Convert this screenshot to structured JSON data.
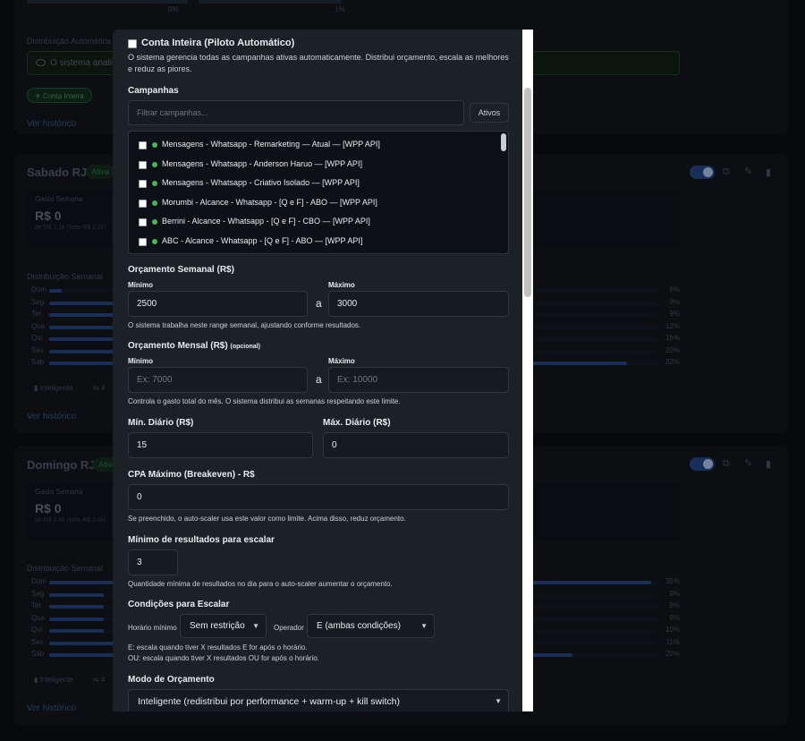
{
  "background": {
    "top_card": {
      "pct_left": "0%",
      "pct_right": "1%",
      "distribution_label": "Distribuição Automática",
      "auto_text": "O sistema analisa",
      "chip_label": "Conta Inteira",
      "history_link": "Ver histórico"
    },
    "cards": [
      {
        "title": "Sabado RJ",
        "status": "Ativa",
        "spend_label": "Gasto Semana",
        "spend_value": "R$ 0",
        "spend_sub": "de R$ 2.1k (falta R$ 2.1k)",
        "distribution_label": "Distribuição Semanal",
        "days": [
          {
            "day": "Dom",
            "pct": "6%",
            "fill": 0.02
          },
          {
            "day": "Seg",
            "pct": "9%",
            "fill": 0.14
          },
          {
            "day": "Ter",
            "pct": "9%",
            "fill": 0.14
          },
          {
            "day": "Qua",
            "pct": "12%",
            "fill": 0.18
          },
          {
            "day": "Qui",
            "pct": "16%",
            "fill": 0.24
          },
          {
            "day": "Sex",
            "pct": "20%",
            "fill": 0.26
          },
          {
            "day": "Sáb",
            "pct": "32%",
            "fill": 0.95
          }
        ],
        "tag_smart": "Inteligente",
        "tag_count": "4",
        "history_link": "Ver histórico"
      },
      {
        "title": "Domingo RJ",
        "status": "Ativa",
        "spend_label": "Gasto Semana",
        "spend_value": "R$ 0",
        "spend_sub": "de R$ 3.6k (falta R$ 3.6k)",
        "distribution_label": "Distribuição Semanal",
        "days": [
          {
            "day": "Dom",
            "pct": "35%",
            "fill": 0.99
          },
          {
            "day": "Seg",
            "pct": "9%",
            "fill": 0.09
          },
          {
            "day": "Ter",
            "pct": "9%",
            "fill": 0.09
          },
          {
            "day": "Qua",
            "pct": "9%",
            "fill": 0.09
          },
          {
            "day": "Qui",
            "pct": "10%",
            "fill": 0.09
          },
          {
            "day": "Sex",
            "pct": "11%",
            "fill": 0.11
          },
          {
            "day": "Sáb",
            "pct": "20%",
            "fill": 0.86
          }
        ],
        "tag_smart": "Inteligente",
        "tag_count": "4",
        "history_link": "Ver histórico"
      }
    ]
  },
  "modal": {
    "autopilot_label": "Conta Inteira (Piloto Automático)",
    "autopilot_desc": "O sistema gerencia todas as campanhas ativas automaticamente. Distribui orçamento, escala as melhores e reduz as piores.",
    "campaigns_heading": "Campanhas",
    "filter_placeholder": "Filtrar campanhas...",
    "active_button": "Ativos",
    "campaigns": [
      "Mensagens - Whatsapp - Remarketing — Atual — [WPP API]",
      "Mensagens - Whatsapp - Anderson Haruo — [WPP API]",
      "Mensagens - Whatsapp - Criativo Isolado — [WPP API]",
      "Morumbi - Alcance - Whatsapp - [Q e F] - ABO — [WPP API]",
      "Berrini - Alcance - Whatsapp - [Q e F] - CBO — [WPP API]",
      "ABC - Alcance - Whatsapp - [Q e F] - ABO — [WPP API]"
    ],
    "weekly": {
      "heading": "Orçamento Semanal (R$)",
      "min_label": "Mínimo",
      "max_label": "Máximo",
      "min_value": "2500",
      "max_value": "3000",
      "separator": "a",
      "help": "O sistema trabalha neste range semanal, ajustando conforme resultados."
    },
    "monthly": {
      "heading": "Orçamento Mensal (R$)",
      "optional": "(opcional)",
      "min_label": "Mínimo",
      "max_label": "Máximo",
      "min_placeholder": "Ex: 7000",
      "max_placeholder": "Ex: 10000",
      "separator": "a",
      "help": "Controla o gasto total do mês. O sistema distribui as semanas respeitando este limite."
    },
    "daily": {
      "min_label": "Mín. Diário (R$)",
      "max_label": "Máx. Diário (R$)",
      "min_value": "15",
      "max_value": "0"
    },
    "cpa": {
      "label": "CPA Máximo (Breakeven) - R$",
      "value": "0",
      "help": "Se preenchido, o auto-scaler usa este valor como limite. Acima disso, reduz orçamento."
    },
    "min_results": {
      "label": "Mínimo de resultados para escalar",
      "value": "3",
      "help": "Quantidade mínima de resultados no dia para o auto-scaler aumentar o orçamento."
    },
    "conditions": {
      "heading": "Condições para Escalar",
      "time_label": "Horário mínimo",
      "time_value": "Sem restrição",
      "operator_label": "Operador",
      "operator_value": "E (ambas condições)",
      "help_e": "E: escala quando tiver X resultados E for após o horário.",
      "help_ou": "OU: escala quando tiver X resultados OU for após o horário."
    },
    "budget_mode": {
      "heading": "Modo de Orçamento",
      "value": "Inteligente (redistribui por performance + warm-up + kill switch)"
    }
  }
}
